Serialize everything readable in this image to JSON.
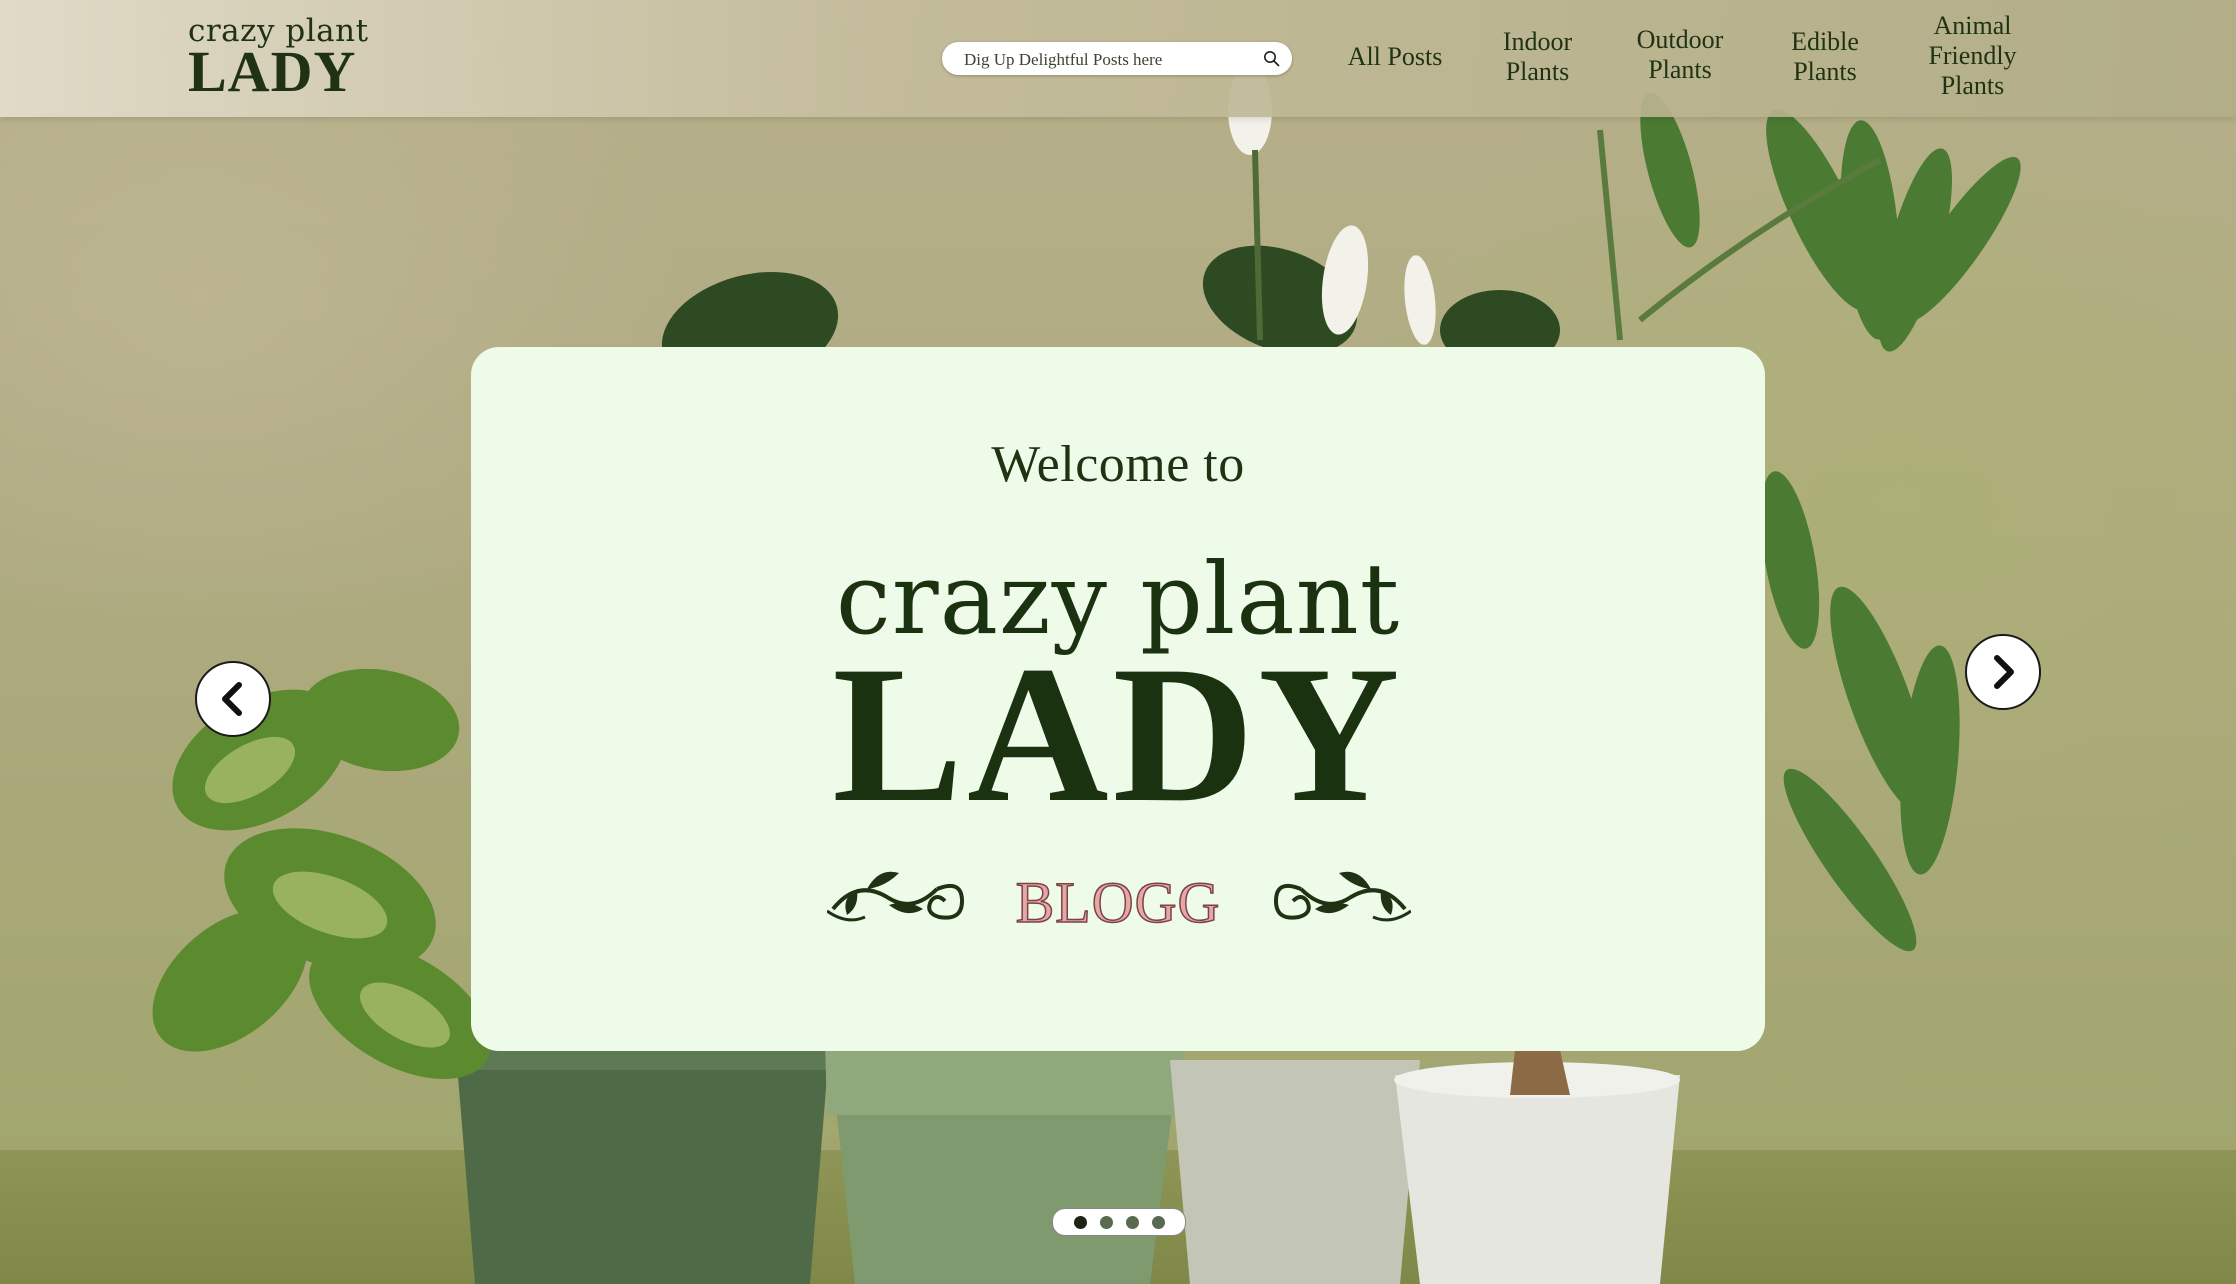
{
  "header": {
    "logo_top": "crazy plant",
    "logo_bottom": "LADY",
    "search_placeholder": "Dig Up Delightful Posts here",
    "search_icon": "search-icon",
    "nav": [
      {
        "label": "All Posts"
      },
      {
        "label": "Indoor\nPlants"
      },
      {
        "label": "Outdoor\nPlants"
      },
      {
        "label": "Edible\nPlants"
      },
      {
        "label": "Animal\nFriendly\nPlants"
      }
    ]
  },
  "hero": {
    "welcome": "Welcome to",
    "title_top": "crazy plant",
    "title_bottom": "LADY",
    "subtitle": "BLOGG",
    "prev_icon": "chevron-left-icon",
    "next_icon": "chevron-right-icon",
    "slide_count": 4,
    "active_slide": 1
  },
  "colors": {
    "brand_dark_green": "#1b3210",
    "card_background": "#effbe9",
    "blogg_pink": "#e6a7a6"
  }
}
